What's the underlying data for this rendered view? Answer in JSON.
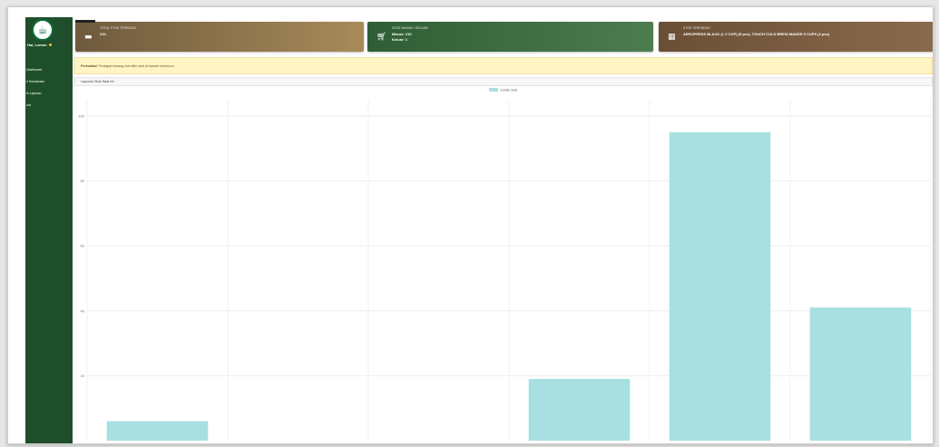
{
  "sidebar": {
    "user_name": "Hai, Lemon",
    "items": [
      {
        "label": "Dashboard"
      },
      {
        "label": "n Kendaraan"
      },
      {
        "label": "ih Laporan"
      },
      {
        "label": "out"
      }
    ]
  },
  "cards": [
    {
      "icon": "archive-icon",
      "title": "TOTAL STOK TERSEDIA",
      "value": "210",
      "value2": ""
    },
    {
      "icon": "cart-icon",
      "title": "STOK MASUK / KELUAR",
      "value": "Masuk: 210",
      "value2": "Keluar: 1"
    },
    {
      "icon": "boxes-icon",
      "title": "STOK TERENDAH",
      "value": "AEROPRESS BLACK (1 X CUP) (5 pcs), TOUCH COLD BREW MAKER 5 CUPS (4 pcs)",
      "value2": ""
    }
  ],
  "alert": {
    "bold": "Perhatian!",
    "text": " Terdapat barang memiliki stok di bawah minimum."
  },
  "panel": {
    "title": "Laporan Stok Saat Ini"
  },
  "colors": {
    "sidebar": "#1f4f2a",
    "bar_fill": "#a8dfe0",
    "alert_bg": "#fff4c4"
  },
  "chart_data": {
    "type": "bar",
    "legend": "Jumlah Stok",
    "legend_position": "top-center",
    "categories": [
      "",
      "",
      "",
      "",
      "",
      ""
    ],
    "values": [
      6,
      0,
      0,
      19,
      95,
      41
    ],
    "ylim": [
      0,
      105
    ],
    "ytick_labels": [
      "100",
      "80",
      "60",
      "40",
      "20"
    ],
    "grid": true
  }
}
